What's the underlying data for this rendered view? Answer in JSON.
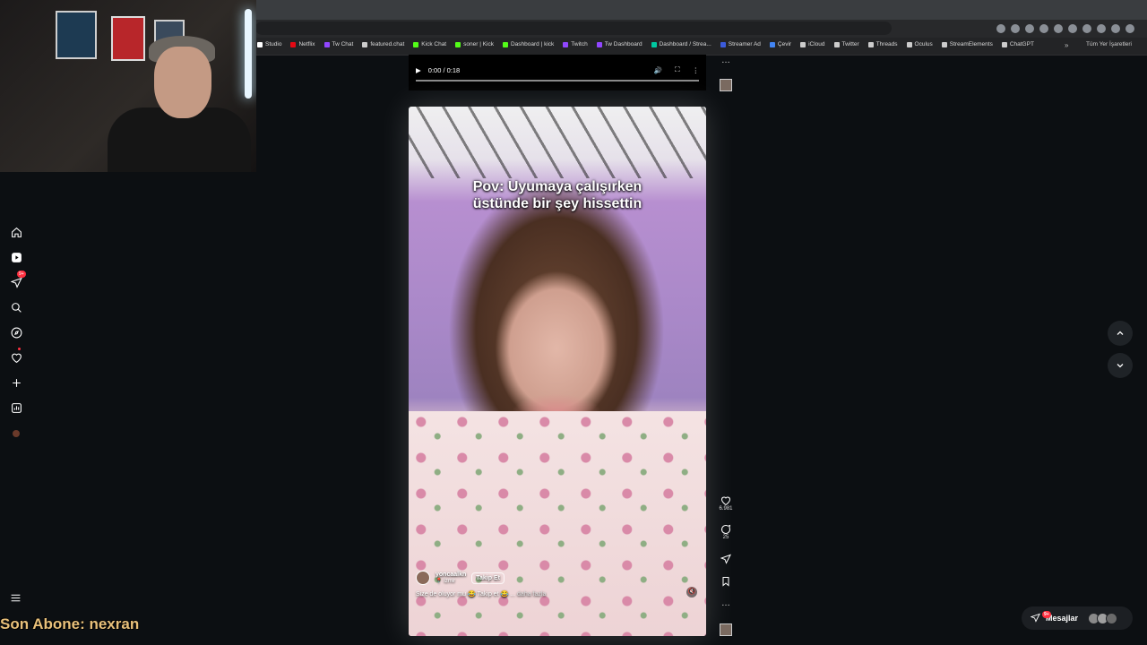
{
  "browser": {
    "bookmarks": [
      {
        "label": "Studio",
        "color": "#ffffff"
      },
      {
        "label": "Netflix",
        "color": "#e50914"
      },
      {
        "label": "Tw Chat",
        "color": "#9146ff"
      },
      {
        "label": "featured.chat",
        "color": "#cccccc"
      },
      {
        "label": "Kick Chat",
        "color": "#53fc18"
      },
      {
        "label": "soner | Kick",
        "color": "#53fc18"
      },
      {
        "label": "Dashboard | kick",
        "color": "#53fc18"
      },
      {
        "label": "Twitch",
        "color": "#9146ff"
      },
      {
        "label": "Tw Dashboard",
        "color": "#9146ff"
      },
      {
        "label": "Dashboard / Strea...",
        "color": "#00c8a0"
      },
      {
        "label": "Streamer Ad",
        "color": "#3b5bdb"
      },
      {
        "label": "Çevir",
        "color": "#4285f4"
      },
      {
        "label": "iCloud",
        "color": "#cccccc"
      },
      {
        "label": "Twitter",
        "color": "#cccccc"
      },
      {
        "label": "Threads",
        "color": "#cccccc"
      },
      {
        "label": "Oculus",
        "color": "#cccccc"
      },
      {
        "label": "StreamElements",
        "color": "#cccccc"
      },
      {
        "label": "ChatGPT",
        "color": "#cccccc"
      }
    ],
    "more": "»",
    "all_bookmarks": "Tüm Yer İşaretleri"
  },
  "sidebar": {
    "notification_badge": "9+"
  },
  "prev_video": {
    "time": "0:00 / 0:18"
  },
  "reel": {
    "caption_line1": "Pov: Uyumaya çalışırken",
    "caption_line2": "üstünde bir şey hissettin",
    "username": "yoncaalkn",
    "location": "İzmir",
    "follow_label": "Takip Et",
    "description": "Size de oluyor mu 😂 Takip et 😂 ...",
    "more_label": "daha fazla"
  },
  "actions": {
    "likes": "6.981",
    "comments": "25"
  },
  "messages": {
    "label": "Mesajlar",
    "badge": "9+"
  },
  "overlay": {
    "last_sub": "Son Abone: nexran"
  },
  "colors": {
    "background": "#0c0f12",
    "badge": "#ff3040",
    "overlay_text": "#e8c07a"
  }
}
